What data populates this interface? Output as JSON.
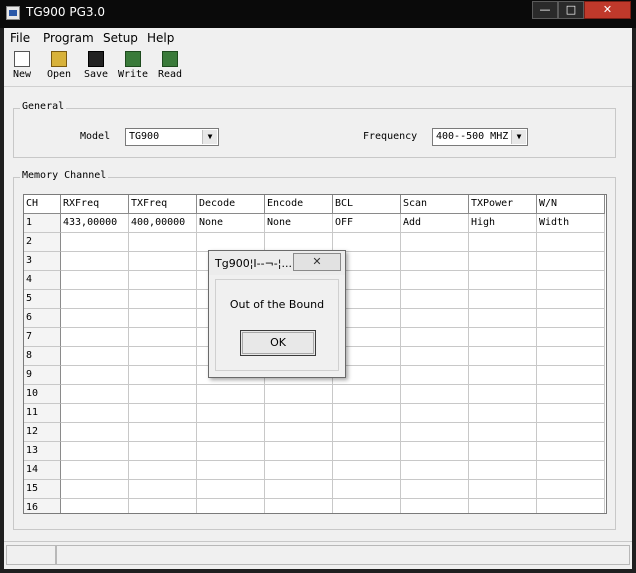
{
  "window": {
    "title": "TG900 PG3.0",
    "buttons": [
      "—",
      "□",
      "✕"
    ]
  },
  "menu": [
    {
      "label": "File"
    },
    {
      "label": "Program"
    },
    {
      "label": "Setup"
    },
    {
      "label": "Help"
    }
  ],
  "toolbar": [
    {
      "label": "New",
      "icon": "new-file-icon"
    },
    {
      "label": "Open",
      "icon": "open-folder-icon"
    },
    {
      "label": "Save",
      "icon": "save-disk-icon"
    },
    {
      "label": "Write",
      "icon": "write-radio-icon"
    },
    {
      "label": "Read",
      "icon": "read-radio-icon"
    }
  ],
  "general": {
    "title": "General",
    "model_label": "Model",
    "model_value": "TG900",
    "frequency_label": "Frequency",
    "frequency_value": "400--500 MHZ"
  },
  "memory": {
    "title": "Memory Channel",
    "columns": [
      "CH",
      "RXFreq",
      "TXFreq",
      "Decode",
      "Encode",
      "BCL",
      "Scan",
      "TXPower",
      "W/N"
    ],
    "rows": [
      [
        "1",
        "433,00000",
        "400,00000",
        "None",
        "None",
        "OFF",
        "Add",
        "High",
        "Width"
      ],
      [
        "2",
        "",
        "",
        "",
        "",
        "",
        "",
        "",
        ""
      ],
      [
        "3",
        "",
        "",
        "",
        "",
        "",
        "",
        "",
        ""
      ],
      [
        "4",
        "",
        "",
        "",
        "",
        "",
        "",
        "",
        ""
      ],
      [
        "5",
        "",
        "",
        "",
        "",
        "",
        "",
        "",
        ""
      ],
      [
        "6",
        "",
        "",
        "",
        "",
        "",
        "",
        "",
        ""
      ],
      [
        "7",
        "",
        "",
        "",
        "",
        "",
        "",
        "",
        ""
      ],
      [
        "8",
        "",
        "",
        "",
        "",
        "",
        "",
        "",
        ""
      ],
      [
        "9",
        "",
        "",
        "",
        "",
        "",
        "",
        "",
        ""
      ],
      [
        "10",
        "",
        "",
        "",
        "",
        "",
        "",
        "",
        ""
      ],
      [
        "11",
        "",
        "",
        "",
        "",
        "",
        "",
        "",
        ""
      ],
      [
        "12",
        "",
        "",
        "",
        "",
        "",
        "",
        "",
        ""
      ],
      [
        "13",
        "",
        "",
        "",
        "",
        "",
        "",
        "",
        ""
      ],
      [
        "14",
        "",
        "",
        "",
        "",
        "",
        "",
        "",
        ""
      ],
      [
        "15",
        "",
        "",
        "",
        "",
        "",
        "",
        "",
        ""
      ],
      [
        "16",
        "",
        "",
        "",
        "",
        "",
        "",
        "",
        ""
      ]
    ]
  },
  "dialog": {
    "title": "Tg900¦I--¬-¦...",
    "close": "✕",
    "message": "Out of the Bound",
    "ok": "OK"
  }
}
